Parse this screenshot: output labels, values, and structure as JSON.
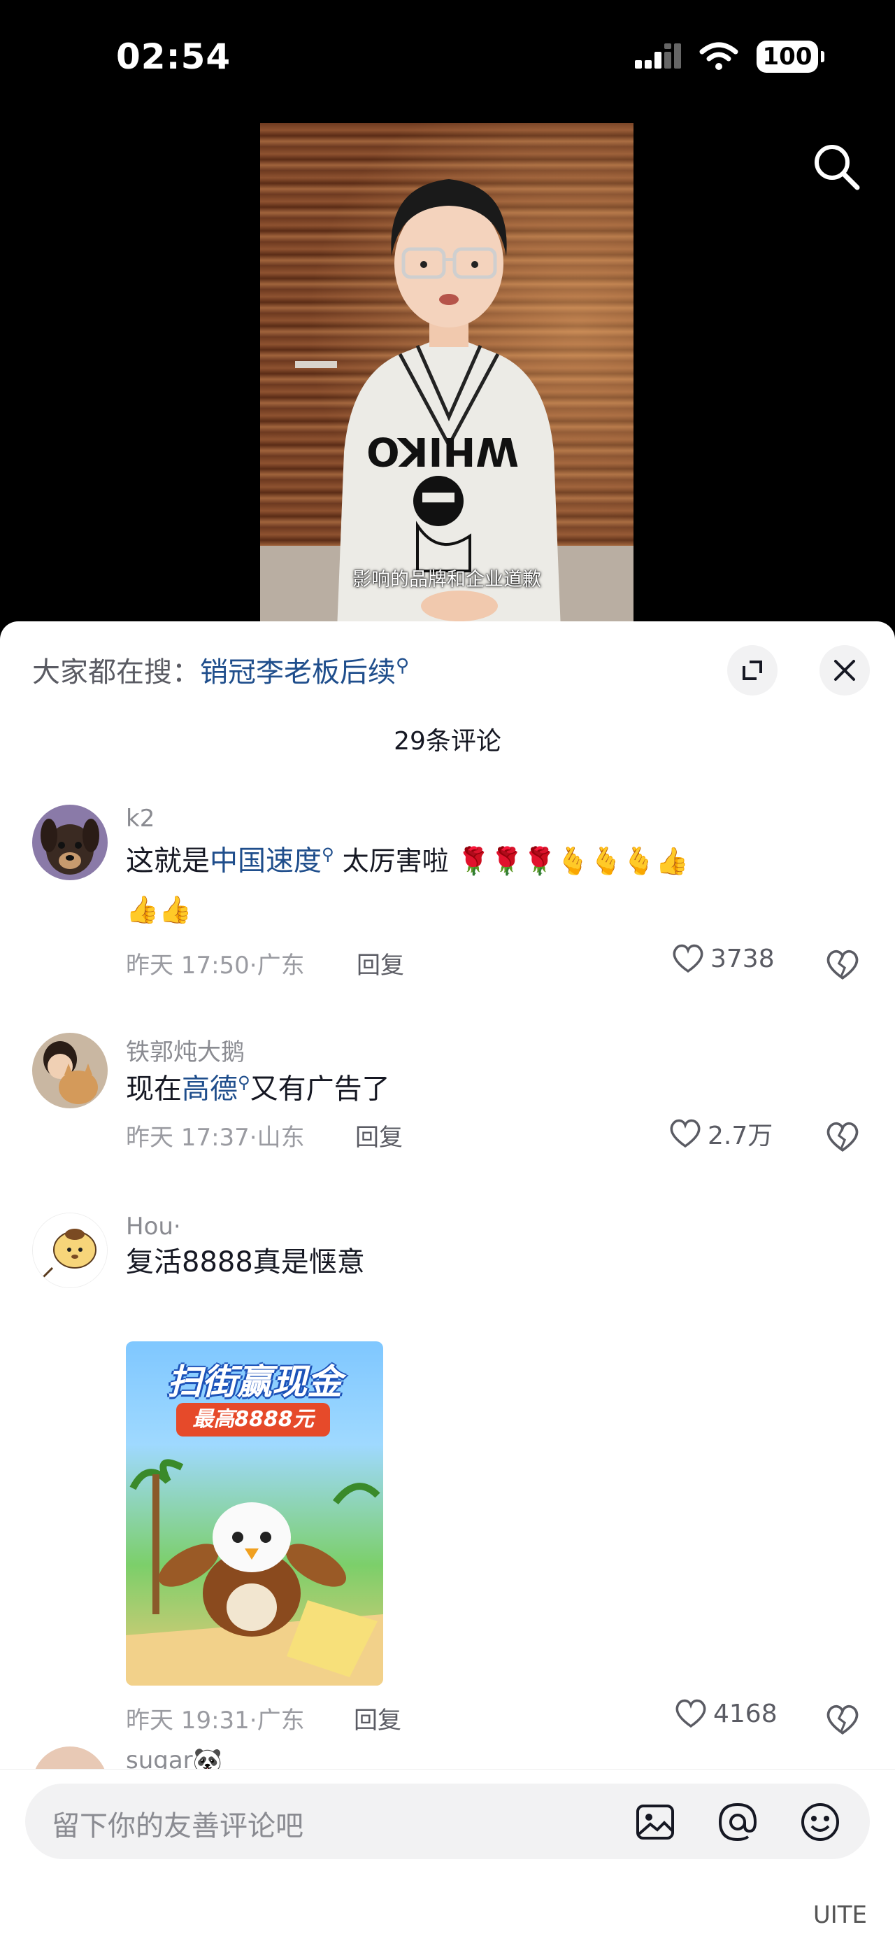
{
  "status_bar": {
    "time": "02:54",
    "battery": "100"
  },
  "video": {
    "subtitle": "影响的品牌和企业道歉"
  },
  "sheet": {
    "hot_search_prefix": "大家都在搜：",
    "hot_search_keyword": "销冠李老板后续",
    "comment_count_title": "29条评论"
  },
  "comments": [
    {
      "username": "k2",
      "text_prefix": "这就是",
      "keyword": "中国速度",
      "text_suffix": "  太厉害啦 🌹🌹🌹🫰🫰🫰👍",
      "text_line2": "👍👍",
      "time": "昨天 17:50",
      "location": "广东",
      "reply": "回复",
      "likes": "3738"
    },
    {
      "username": "铁郭炖大鹅",
      "text_prefix": "现在",
      "keyword": "高德",
      "text_suffix": "又有广告了",
      "time": "昨天 17:37",
      "location": "山东",
      "reply": "回复",
      "likes": "2.7万"
    },
    {
      "username": "Hou·",
      "text": "复活8888真是惬意",
      "image_title": "扫街赢现金",
      "image_sub": "最高8888元",
      "time": "昨天 19:31",
      "location": "广东",
      "reply": "回复",
      "likes": "4168"
    },
    {
      "username": "sugar🐼"
    }
  ],
  "input": {
    "placeholder": "留下你的友善评论吧",
    "icons": [
      "image-icon",
      "at-icon",
      "emoji-icon"
    ]
  },
  "home_indicator_text": "UITE",
  "colors": {
    "keyword_blue": "#1f4e8c",
    "meta_gray": "#9a9ba1",
    "sheet_bg": "#ffffff"
  }
}
